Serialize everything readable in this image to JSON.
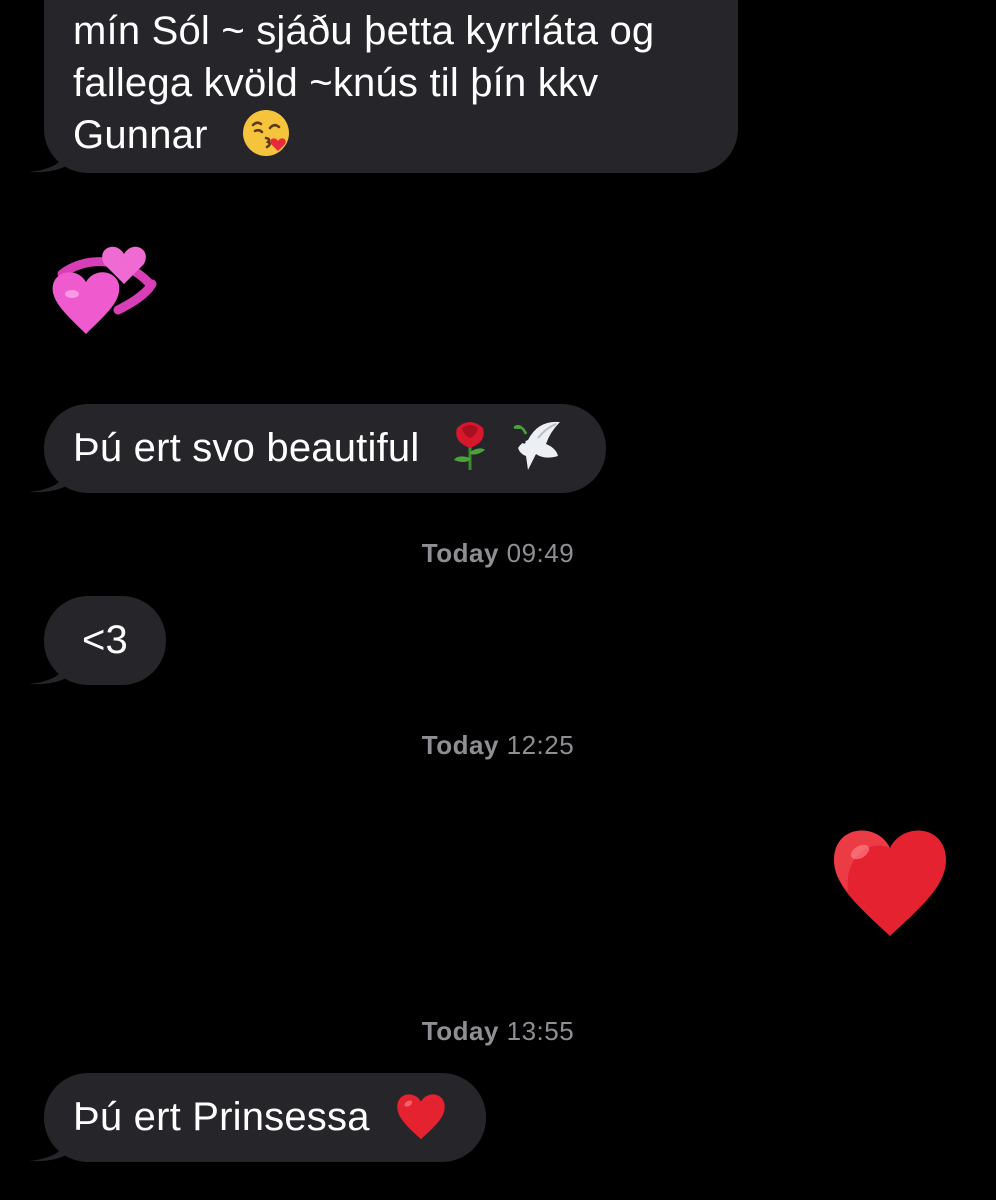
{
  "thread": {
    "messages": [
      {
        "kind": "incoming",
        "text_lines": [
          "mín Sól ~ sjáðu þetta kyrrláta og",
          "fallega kvöld ~knús til þín kkv",
          "Gunnar"
        ],
        "emoji": "face-blowing-kiss"
      },
      {
        "kind": "incoming-emoji",
        "emoji": "revolving-hearts"
      },
      {
        "kind": "incoming",
        "text": "Þú ert svo beautiful",
        "emojis": [
          "rose",
          "dove"
        ]
      },
      {
        "kind": "timestamp",
        "day": "Today",
        "time": "09:49"
      },
      {
        "kind": "incoming",
        "text": "<3"
      },
      {
        "kind": "timestamp",
        "day": "Today",
        "time": "12:25"
      },
      {
        "kind": "outgoing-emoji",
        "emoji": "red-heart"
      },
      {
        "kind": "timestamp",
        "day": "Today",
        "time": "13:55"
      },
      {
        "kind": "incoming",
        "text": "Þú ert Prinsessa",
        "emoji": "red-heart"
      }
    ]
  },
  "colors": {
    "background": "#000000",
    "incoming_bubble": "#26252a",
    "timestamp": "#8e8e93"
  }
}
